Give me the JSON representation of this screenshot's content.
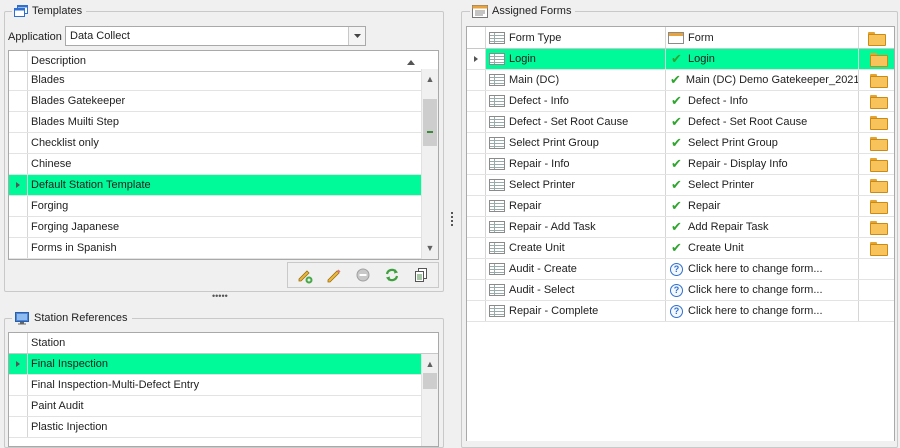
{
  "templates": {
    "title": "Templates",
    "application_label": "Application",
    "application_value": "Data Collect",
    "column_header": "Description",
    "rows": [
      {
        "label": "Blades"
      },
      {
        "label": "Blades Gatekeeper"
      },
      {
        "label": "Blades Muilti Step"
      },
      {
        "label": "Checklist only"
      },
      {
        "label": "Chinese"
      },
      {
        "label": "Default Station Template",
        "selected": true
      },
      {
        "label": "Forging"
      },
      {
        "label": "Forging Japanese"
      },
      {
        "label": "Forms in Spanish"
      }
    ],
    "toolbar_icons": [
      "edit-icon",
      "rename-icon",
      "delete-icon",
      "refresh-icon",
      "copy-icon"
    ]
  },
  "station_references": {
    "title": "Station References",
    "column_header": "Station",
    "rows": [
      {
        "label": "Final Inspection",
        "selected": true
      },
      {
        "label": "Final Inspection-Multi-Defect Entry"
      },
      {
        "label": "Paint Audit"
      },
      {
        "label": "Plastic Injection"
      }
    ]
  },
  "assigned_forms": {
    "title": "Assigned Forms",
    "col_form_type": "Form Type",
    "col_form": "Form",
    "rows": [
      {
        "form_type": "Login",
        "form": "Login",
        "status": "assigned",
        "selected": true
      },
      {
        "form_type": "Main (DC)",
        "form": "Main (DC) Demo Gatekeeper_2021",
        "status": "assigned"
      },
      {
        "form_type": "Defect - Info",
        "form": "Defect - Info",
        "status": "assigned"
      },
      {
        "form_type": "Defect - Set Root Cause",
        "form": "Defect - Set Root Cause",
        "status": "assigned"
      },
      {
        "form_type": "Select Print Group",
        "form": "Select Print Group",
        "status": "assigned"
      },
      {
        "form_type": "Repair - Info",
        "form": "Repair - Display Info",
        "status": "assigned"
      },
      {
        "form_type": "Select Printer",
        "form": "Select Printer",
        "status": "assigned"
      },
      {
        "form_type": "Repair",
        "form": "Repair",
        "status": "assigned"
      },
      {
        "form_type": "Repair - Add Task",
        "form": "Add Repair Task",
        "status": "assigned"
      },
      {
        "form_type": "Create Unit",
        "form": "Create Unit",
        "status": "assigned"
      },
      {
        "form_type": "Audit - Create",
        "form": "Click here to change form...",
        "status": "unassigned"
      },
      {
        "form_type": "Audit - Select",
        "form": "Click here to change form...",
        "status": "unassigned"
      },
      {
        "form_type": "Repair - Complete",
        "form": "Click here to change form...",
        "status": "unassigned"
      }
    ]
  },
  "colors": {
    "selection": "#00fa9a",
    "check": "#2ea52e",
    "folder": "#f7c35a"
  }
}
